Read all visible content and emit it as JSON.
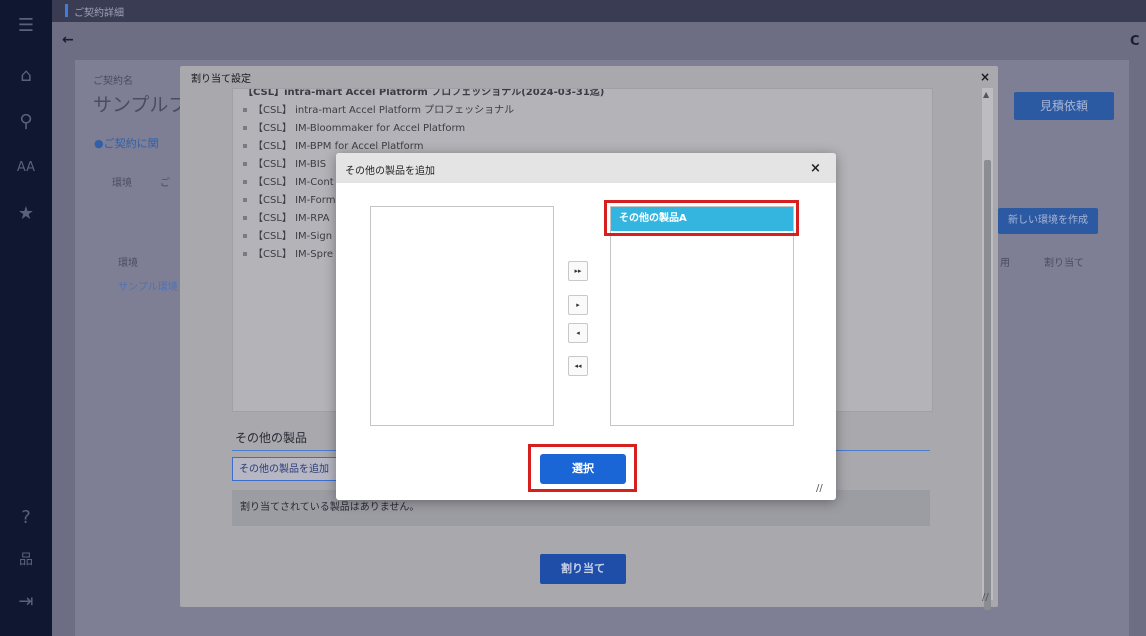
{
  "nav": {
    "menu_icon": "☰",
    "home_icon": "⌂",
    "search_icon": "⚲",
    "font_icon": "AA",
    "star_icon": "★",
    "help_icon": "?",
    "sitemap_icon": "品",
    "logout_icon": "⇥"
  },
  "background": {
    "breadcrumb": "ご契約詳細",
    "back_icon": "←",
    "refresh_icon": "C",
    "contract_label": "ご契約名",
    "contract_name": "サンプルプ",
    "contract_info": "ご契約に関",
    "tab_env": "環境",
    "tab_other": "ご",
    "col_env": "環境",
    "row_env": "サンプル環境",
    "quote_button": "見積依頼",
    "new_env_button": "新しい環境を作成",
    "col_use": "用",
    "col_assign": "割り当て"
  },
  "outer_modal": {
    "title": "割り当て設定",
    "close": "×",
    "products_top": "【CSL】intra-mart Accel Platform プロフェッショナル(2024-03-31迄)",
    "products": [
      "【CSL】 intra-mart Accel Platform プロフェッショナル",
      "【CSL】 IM-Bloommaker for Accel Platform",
      "【CSL】 IM-BPM for Accel Platform",
      "【CSL】 IM-BIS",
      "【CSL】 IM-Cont",
      "【CSL】 IM-Form",
      "【CSL】 IM-RPA",
      "【CSL】 IM-Sign",
      "【CSL】 IM-Spre"
    ],
    "other_products_heading": "その他の製品",
    "add_other_button": "その他の製品を追加",
    "no_products_text": "割り当てされている製品はありません。",
    "assign_button": "割り当て"
  },
  "inner_modal": {
    "title": "その他の製品を追加",
    "close": "×",
    "available_items": [],
    "selected_items": [
      "その他の製品A"
    ],
    "move_all_right": "▸▸",
    "move_right": "▸",
    "move_left": "◂",
    "move_all_left": "◂◂",
    "select_button": "選択"
  },
  "colors": {
    "highlight": "#d62020",
    "selected_item": "#34b5e0",
    "primary_button": "#1a66d6"
  }
}
